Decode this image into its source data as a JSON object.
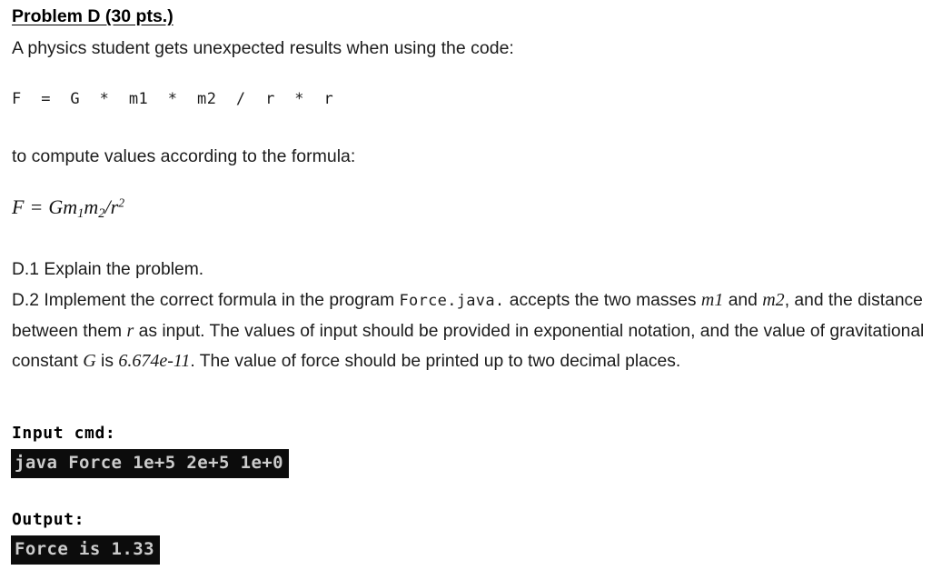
{
  "document": {
    "heading": "Problem D (30 pts.)",
    "intro": "A physics student gets unexpected results when using the code:",
    "buggy_code": "F  =  G  *  m1  *  m2  /  r  *  r",
    "formula_lead": "to compute values according to the formula:",
    "formula": {
      "lhs": "F",
      "equals": "=",
      "rhs_G": "Gm",
      "sub1": "1",
      "rhs_m": "m",
      "sub2": "2",
      "slash_r": "/r",
      "sup2": "2",
      "plain": "F = Gm1m2/r2"
    },
    "tasks": {
      "d1": "D.1 Explain the problem.",
      "d2_part1": "D.2 Implement the correct formula in the program ",
      "d2_code": "Force.java.",
      "d2_part2": " accepts the two masses ",
      "d2_m1": "m1",
      "d2_part3": " and ",
      "d2_m2": "m2",
      "d2_part4": ", and the distance between them ",
      "d2_r": "r",
      "d2_part5": " as input.  The values of input should be provided in exponential notation, and the value of gravitational constant ",
      "d2_G": "G",
      "d2_part6": " is ",
      "d2_const": "6.674e-11",
      "d2_part7": ". The value of force should be printed up to two decimal places."
    },
    "terminal": {
      "input_label": "Input cmd:",
      "input_command": "java Force 1e+5 2e+5 1e+0",
      "output_label": "Output:",
      "output_text": "Force is 1.33"
    },
    "colors": {
      "page_background": "#ffffff",
      "body_text": "#1b1b1b",
      "heading_text": "#000000",
      "terminal_background": "#0c0c0c",
      "terminal_text": "#cccccc"
    }
  }
}
